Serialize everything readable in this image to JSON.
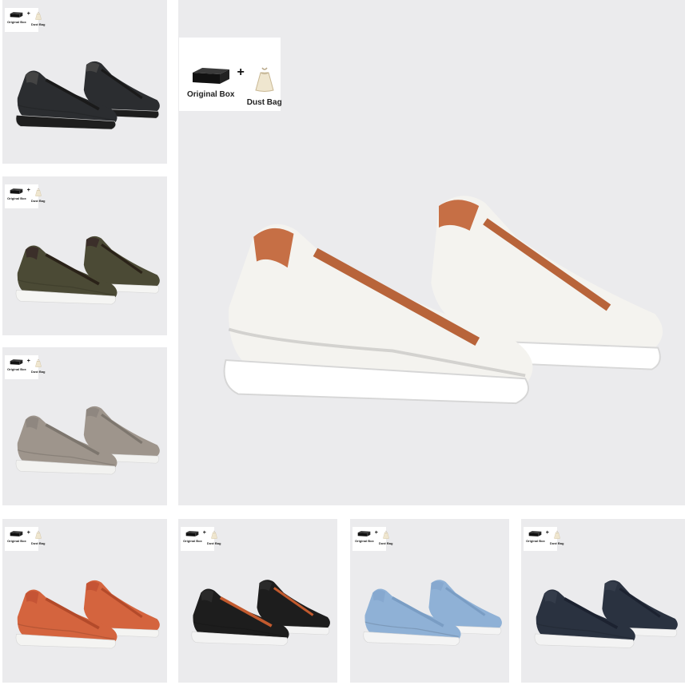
{
  "badge": {
    "box_label": "Original Box",
    "bag_label": "Dust Bag",
    "plus": "+"
  },
  "featured": {
    "color": "#f4f3ef",
    "accent": "#b8643a",
    "sole": "#ffffff",
    "inner": "#c66f45"
  },
  "variants": [
    {
      "name": "black-leather",
      "color": "#2b2d30",
      "accent": "#1a1a1a",
      "sole": "#1e1e1e",
      "inner": "#444"
    },
    {
      "name": "olive-suede",
      "color": "#4b4a35",
      "accent": "#2a2218",
      "sole": "#f5f5f3",
      "inner": "#3b2f2a"
    },
    {
      "name": "grey-suede",
      "color": "#9e958c",
      "accent": "#7d766e",
      "sole": "#f2f2f0",
      "inner": "#8f8780"
    },
    {
      "name": "orange-suede",
      "color": "#d4643e",
      "accent": "#b34a2a",
      "sole": "#f4f4f2",
      "inner": "#c55435"
    },
    {
      "name": "black-suede",
      "color": "#1d1d1d",
      "accent": "#c25a2e",
      "sole": "#f3f3f3",
      "inner": "#2a2a2a"
    },
    {
      "name": "light-blue-suede",
      "color": "#8fb1d6",
      "accent": "#7a9dc4",
      "sole": "#f4f4f4",
      "inner": "#86a8cf"
    },
    {
      "name": "navy-leather",
      "color": "#2a3240",
      "accent": "#1c2230",
      "sole": "#f3f3f3",
      "inner": "#343c4a"
    }
  ]
}
